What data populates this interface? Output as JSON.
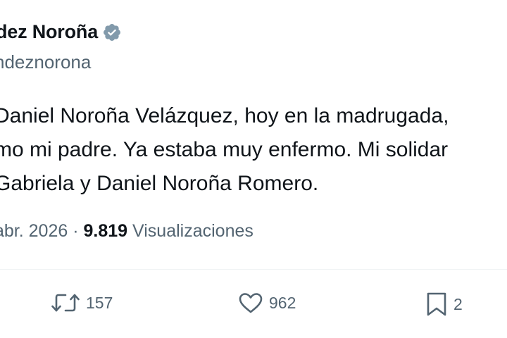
{
  "user": {
    "display_name": "dez Noroña",
    "handle": "ndeznorona",
    "verified_icon": "verified-badge-icon",
    "verified_color": "#829aab"
  },
  "tweet": {
    "lines": [
      "Daniel Noroña Velázquez, hoy en la madrugada,",
      "mo mi padre. Ya estaba muy enfermo. Mi solidar",
      "Gabriela y Daniel Noroña Romero."
    ]
  },
  "meta": {
    "date": "abr. 2026",
    "separator": "·",
    "views_count": "9.819",
    "views_label": "Visualizaciones"
  },
  "actions": {
    "retweet": {
      "icon": "retweet-icon",
      "count": "157"
    },
    "like": {
      "icon": "heart-icon",
      "count": "962"
    },
    "bookmark": {
      "icon": "bookmark-icon",
      "count": "2"
    }
  },
  "colors": {
    "text": "#0f1419",
    "secondary": "#536471",
    "divider": "#eff3f4"
  }
}
